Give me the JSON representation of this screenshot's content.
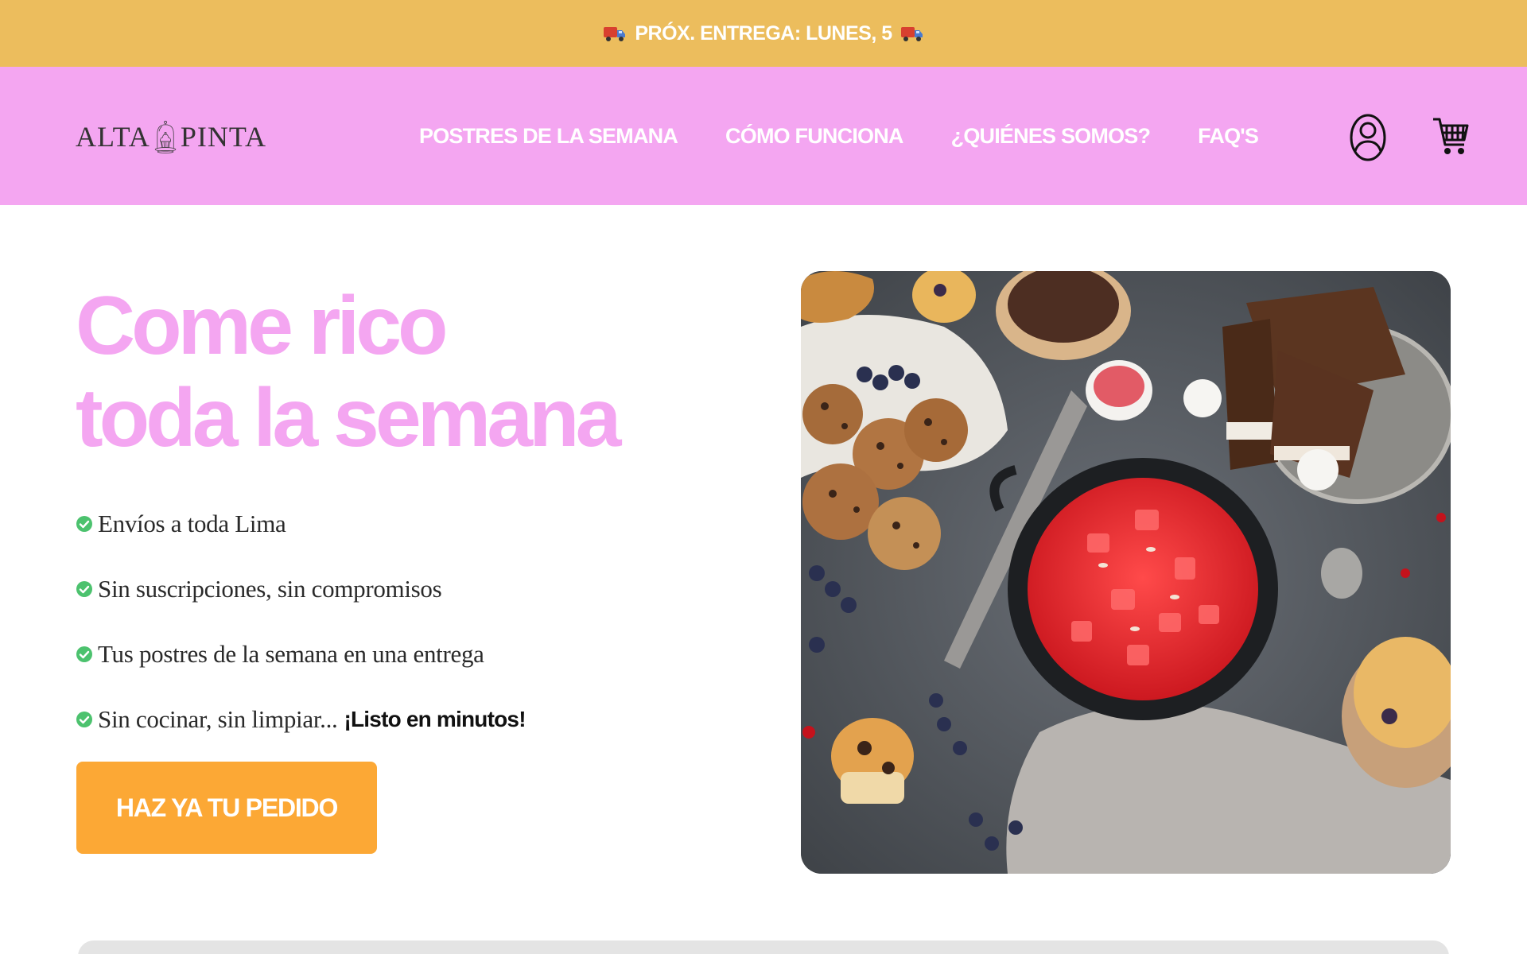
{
  "announcement": {
    "text": "PRÓX. ENTREGA: LUNES, 5",
    "icon": "truck-icon",
    "background": "#ecbd5d"
  },
  "header": {
    "background": "#f4a6f1",
    "logo": {
      "left_word": "ALTA",
      "right_word": "PINTA",
      "icon": "cupcake-dome-icon"
    },
    "nav": [
      {
        "label": "POSTRES DE LA SEMANA"
      },
      {
        "label": "CÓMO FUNCIONA"
      },
      {
        "label": "¿QUIÉNES SOMOS?"
      },
      {
        "label": "FAQ'S"
      }
    ],
    "user_icon": "user-account-icon",
    "cart_icon": "shopping-cart-icon"
  },
  "hero": {
    "title_line1": "Come rico",
    "title_line2": "toda la semana",
    "title_color": "#f4a6f1",
    "features": [
      {
        "text": "Envíos a toda Lima",
        "bold": ""
      },
      {
        "text": "Sin suscripciones, sin compromisos",
        "bold": ""
      },
      {
        "text": "Tus postres de la semana en una entrega",
        "bold": ""
      },
      {
        "text": "Sin cocinar, sin limpiar...",
        "bold": "¡Listo en minutos!"
      }
    ],
    "feature_icon": "check-circle-icon",
    "cta_label": "HAZ YA TU PEDIDO",
    "cta_color": "#fca835",
    "image": "desserts-photo"
  }
}
